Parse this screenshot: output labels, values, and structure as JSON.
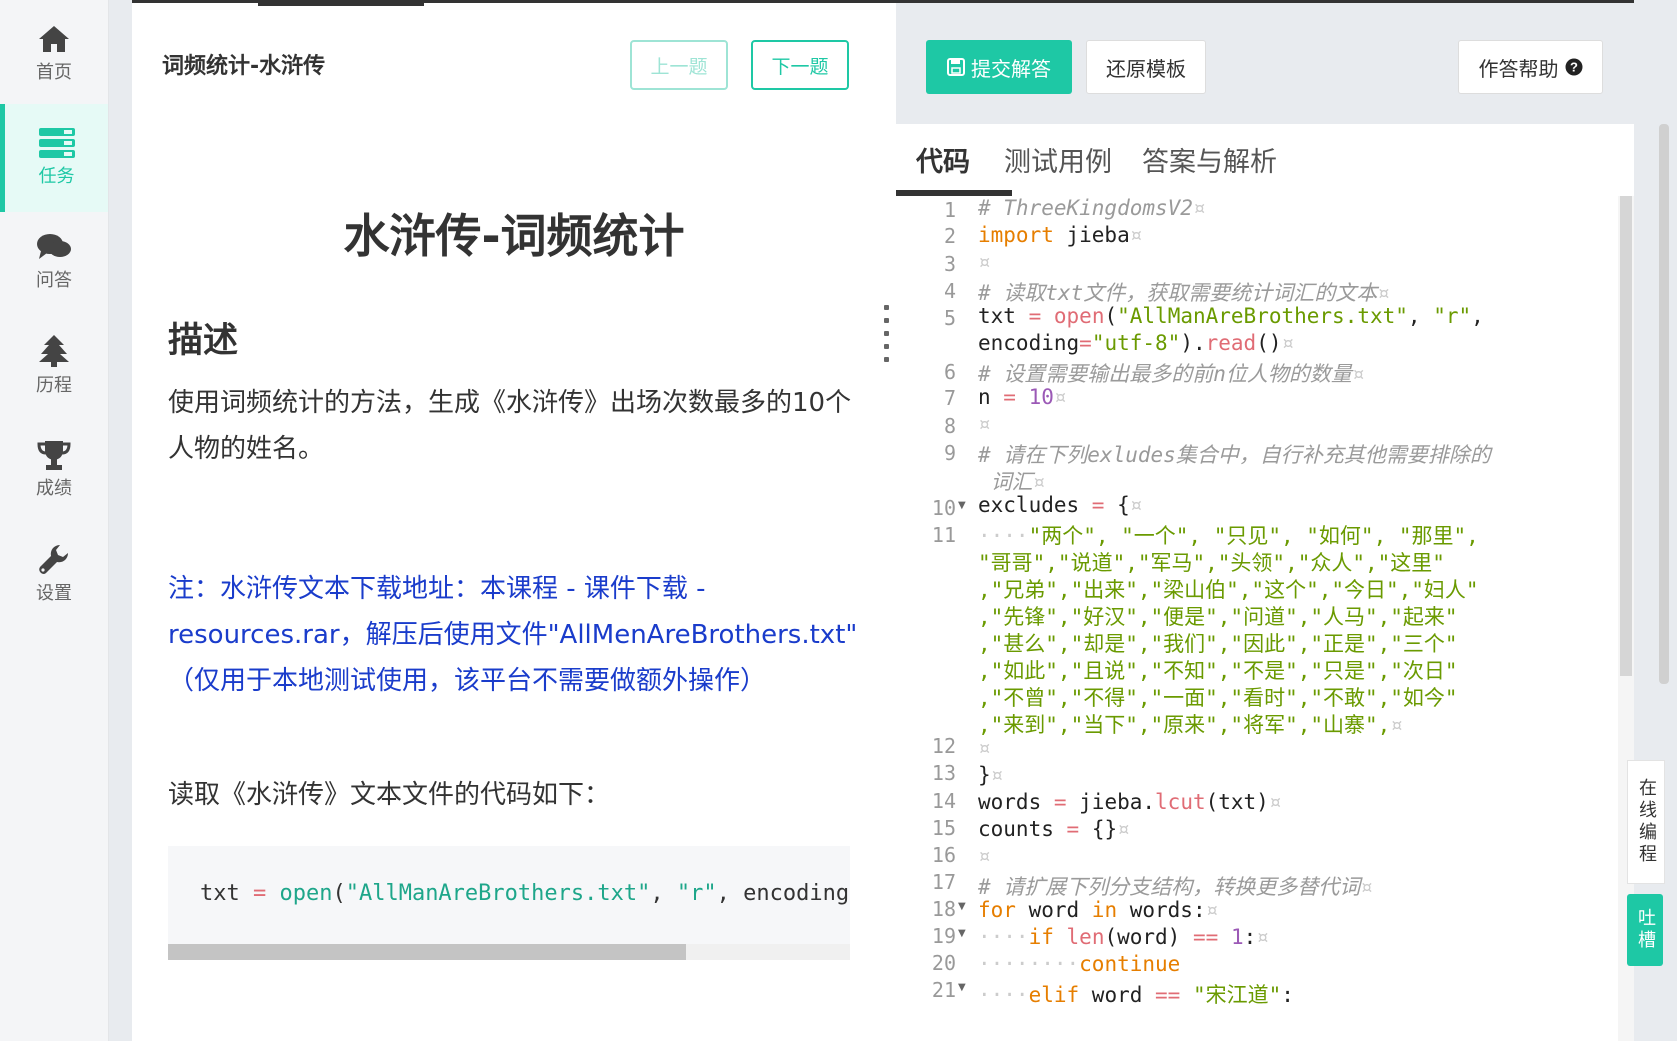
{
  "nav": [
    {
      "label": "首页",
      "icon": "home-icon"
    },
    {
      "label": "任务",
      "icon": "tasks-icon"
    },
    {
      "label": "问答",
      "icon": "comments-icon"
    },
    {
      "label": "历程",
      "icon": "tree-icon"
    },
    {
      "label": "成绩",
      "icon": "trophy-icon"
    },
    {
      "label": "设置",
      "icon": "wrench-icon"
    }
  ],
  "task": {
    "title": "词频统计-水浒传",
    "prev_label": "上一题",
    "next_label": "下一题"
  },
  "article": {
    "title": "水浒传-词频统计",
    "heading": "描述",
    "desc": "使用词频统计的方法，生成《水浒传》出场次数最多的10个人物的姓名。",
    "note": "注：水浒传文本下载地址：本课程 - 课件下载 - resources.rar，解压后使用文件\"AllMenAreBrothers.txt\" （仅用于本地测试使用，该平台不需要做额外操作）",
    "read_line": "读取《水浒传》文本文件的代码如下：",
    "snippet": "txt = open(\"AllManAreBrothers.txt\", \"r\", encoding"
  },
  "toolbar": {
    "submit_label": "提交解答",
    "reset_label": "还原模板",
    "help_label": "作答帮助"
  },
  "tabs": [
    "代码",
    "测试用例",
    "答案与解析"
  ],
  "float": {
    "online": "在线编程",
    "tucao": "吐槽"
  },
  "colors": {
    "accent": "#1ec8a5",
    "note": "#1a3ccb"
  }
}
